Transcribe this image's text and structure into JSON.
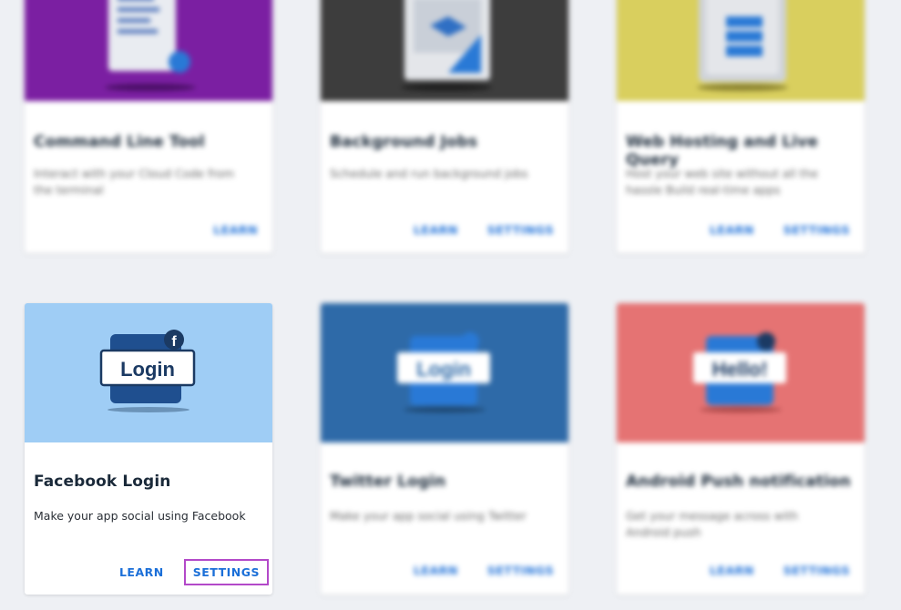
{
  "colors": {
    "page_bg": "#eef0f4",
    "link_blue": "#1b6fd8",
    "highlight": "#b349c9"
  },
  "cards": [
    {
      "title": "Command Line Tool",
      "description": "Interact with your Cloud Code from the terminal",
      "learn": "LEARN",
      "hero_color": "#7b1fa2",
      "hero_icon": "document-icon"
    },
    {
      "title": "Background Jobs",
      "description": "Schedule and run background jobs",
      "learn": "LEARN",
      "settings": "SETTINGS",
      "hero_color": "#3d3d3d",
      "hero_icon": "jobs-icon"
    },
    {
      "title": "Web Hosting and Live Query",
      "description": "Host your web site without all the hassle Build real-time apps",
      "learn": "LEARN",
      "settings": "SETTINGS",
      "hero_color": "#d9cf5e",
      "hero_icon": "server-icon"
    },
    {
      "title": "Facebook Login",
      "description": "Make your app social using Facebook",
      "learn": "LEARN",
      "settings": "SETTINGS",
      "hero_color": "#9fcdf5",
      "hero_icon": "facebook-icon",
      "hero_text": "Login"
    },
    {
      "title": "Twitter Login",
      "description": "Make your app social using Twitter",
      "learn": "LEARN",
      "settings": "SETTINGS",
      "hero_color": "#2e6aa8",
      "hero_icon": "twitter-icon",
      "hero_text": "Login"
    },
    {
      "title": "Android Push notification",
      "description": "Get your message across with Android push",
      "learn": "LEARN",
      "settings": "SETTINGS",
      "hero_color": "#e57373",
      "hero_icon": "android-icon",
      "hero_text": "Hello!"
    }
  ]
}
